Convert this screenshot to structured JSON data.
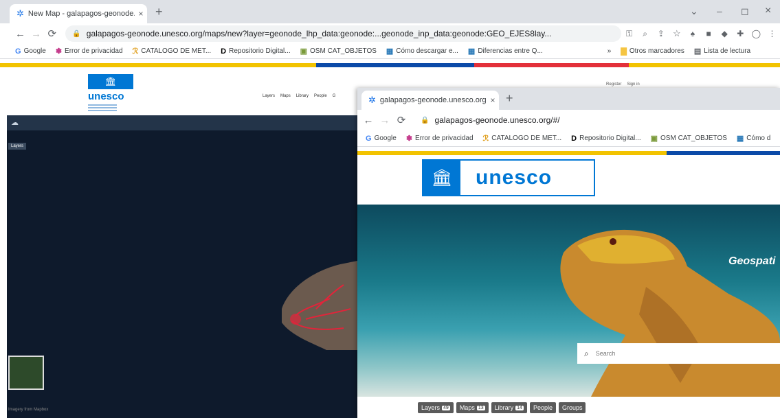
{
  "back_window": {
    "tab": {
      "title": "New Map - galapagos-geonode...",
      "close": "×"
    },
    "new_tab": "+",
    "controls": {
      "dropdown": "⌄",
      "minimize": "–",
      "maximize": "◻",
      "close": "×"
    },
    "address": "galapagos-geonode.unesco.org/maps/new?layer=geonode_lhp_data:geonode:...geonode_inp_data:geonode:GEO_EJES8lay...",
    "bookmarks": [
      {
        "icon": "G",
        "label": "Google"
      },
      {
        "icon": "✽",
        "label": "Error de privacidad"
      },
      {
        "icon": "ℛ",
        "label": "CATALOGO DE MET..."
      },
      {
        "icon": "D",
        "label": "Repositorio Digital..."
      },
      {
        "icon": "▣",
        "label": "OSM CAT_OBJETOS"
      },
      {
        "icon": "▦",
        "label": "Cómo descargar e..."
      },
      {
        "icon": "▦",
        "label": "Diferencias entre Q..."
      }
    ],
    "bookmarks_more": "»",
    "other_bookmarks": "Otros marcadores",
    "reading_list": "Lista de lectura",
    "site_logo": "unesco",
    "nav": [
      "Layers",
      "Maps",
      "Library",
      "People",
      "G"
    ],
    "top_right": [
      "Register",
      "Sign in"
    ],
    "layers_button": "Layers",
    "attribution": "Imagery from Mapbox"
  },
  "front_window": {
    "tab": {
      "title": "galapagos-geonode.unesco.org",
      "close": "×"
    },
    "new_tab": "+",
    "address": "galapagos-geonode.unesco.org/#/",
    "bookmarks": [
      {
        "icon": "G",
        "label": "Google"
      },
      {
        "icon": "✽",
        "label": "Error de privacidad"
      },
      {
        "icon": "ℛ",
        "label": "CATALOGO DE MET..."
      },
      {
        "icon": "D",
        "label": "Repositorio Digital..."
      },
      {
        "icon": "▣",
        "label": "OSM CAT_OBJETOS"
      },
      {
        "icon": "▦",
        "label": "Cómo d"
      }
    ],
    "logo_text": "unesco",
    "hero_title": "Geospati",
    "search_placeholder": "Search",
    "bottom_nav": [
      {
        "label": "Layers",
        "count": "49"
      },
      {
        "label": "Maps",
        "count": "13"
      },
      {
        "label": "Library",
        "count": "14"
      },
      {
        "label": "People",
        "count": ""
      },
      {
        "label": "Groups",
        "count": ""
      }
    ]
  },
  "colors": {
    "unesco_blue": "#0077d4",
    "chrome_tab_bg": "#dee1e6",
    "map_dark": "#0e1a2c",
    "stripe_yellow": "#f2c300",
    "stripe_red": "#e3303a"
  }
}
